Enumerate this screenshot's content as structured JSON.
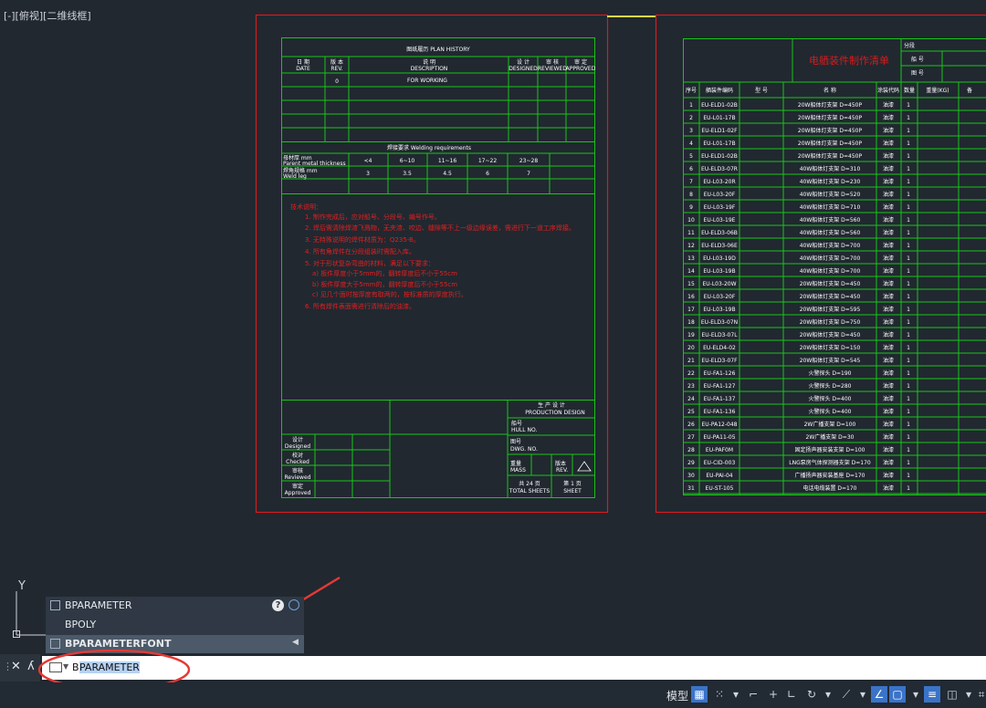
{
  "viewport": {
    "label": "[-][俯视][二维线框]"
  },
  "drawing": {
    "plan_history": {
      "title": "图纸履历 PLAN HISTORY",
      "headers": [
        {
          "cn": "日 期",
          "en": "DATE"
        },
        {
          "cn": "版 本",
          "en": "REV."
        },
        {
          "cn": "说 明",
          "en": "DESCRIPTION"
        },
        {
          "cn": "设 计",
          "en": "DESIGNED"
        },
        {
          "cn": "审 核",
          "en": "REVIEWED"
        },
        {
          "cn": "审 定",
          "en": "APPROVED"
        }
      ],
      "row1": {
        "rev": "0",
        "desc": "FOR WORKING"
      }
    },
    "welding": {
      "title": "焊接要求 Welding requirements",
      "row1_label_cn": "母材厚 mm",
      "row1_label_en": "Parent metal thickness",
      "row2_label_cn": "焊角规格 mm",
      "row2_label_en": "Weld leg",
      "thickness": [
        "<4",
        "6~10",
        "11~16",
        "17~22",
        "23~28"
      ],
      "leg": [
        "3",
        "3.5",
        "4.5",
        "6",
        "7"
      ]
    },
    "notes": [
      "技术说明：",
      "1. 制作完成后，应对船号、分段号、编号作号。",
      "2. 焊后需清除焊渣飞溅物，无夹渣、咬边、缝隙等不上一级边缘误差，需进行下一道工序焊接。",
      "3. 无特殊说明的焊件材质为：Q235-B。",
      "4. 所有角焊件在分段组装时需配入库。",
      "5. 对于形状复杂弯曲的材料，满足以下要求：",
      "a) 板件厚度小于5mm的，翻转厚度后不小于55cm",
      "b) 板件厚度大于5mm的，翻转厚度后不小于55cm",
      "c) 见几个面时按厚度有取两的，按标准质的厚度执行。",
      "6. 所有焊件表面需进行清除后的油漆。"
    ],
    "production": {
      "cn": "生 产 设 计",
      "en": "PRODUCTION DESIGN"
    },
    "hull": {
      "cn": "船号",
      "en": "HULL NO."
    },
    "dwg": {
      "cn": "图号",
      "en": "DWG. NO."
    },
    "mass": {
      "cn": "重量",
      "en": "MASS"
    },
    "rev": {
      "cn": "版本",
      "en": "REV."
    },
    "total": {
      "cn": "共 24 页",
      "en": "TOTAL SHEETS"
    },
    "sheet": {
      "cn": "第 1 页",
      "en": "SHEET"
    },
    "signoff": [
      {
        "cn": "设计",
        "en": "Designed"
      },
      {
        "cn": "校对",
        "en": "Checked"
      },
      {
        "cn": "审核",
        "en": "Reviewed"
      },
      {
        "cn": "审定",
        "en": "Approved"
      }
    ],
    "list": {
      "title": "电舾装件制作清单",
      "side": [
        "分段",
        "船 号",
        "图 号"
      ],
      "headers": [
        "序号",
        "舾装件编码",
        "型 号",
        "名 称",
        "涂装代码",
        "数量",
        "重量(KG)",
        "备"
      ],
      "rows": [
        [
          "1",
          "EU-ELD1-02B",
          "20W船体灯支架 D=450P"
        ],
        [
          "2",
          "EU-L01-17B",
          "20W船体灯支架 D=450P"
        ],
        [
          "3",
          "EU-ELD1-02F",
          "20W船体灯支架 D=450P"
        ],
        [
          "4",
          "EU-L01-17B",
          "20W船体灯支架 D=450P"
        ],
        [
          "5",
          "EU-ELD1-02B",
          "20W船体灯支架 D=450P"
        ],
        [
          "6",
          "EU-ELD3-07R",
          "40W船体灯支架 D=310"
        ],
        [
          "7",
          "EU-L03-20R",
          "40W船体灯支架 D=230"
        ],
        [
          "8",
          "EU-L03-20F",
          "40W船体灯支架 D=520"
        ],
        [
          "9",
          "EU-L03-19F",
          "40W船体灯支架 D=710"
        ],
        [
          "10",
          "EU-L03-19E",
          "40W船体灯支架 D=560"
        ],
        [
          "11",
          "EU-ELD3-06B",
          "40W船体灯支架 D=560"
        ],
        [
          "12",
          "EU-ELD3-06E",
          "40W船体灯支架 D=700"
        ],
        [
          "13",
          "EU-L03-19D",
          "40W船体灯支架 D=700"
        ],
        [
          "14",
          "EU-L03-19B",
          "40W船体灯支架 D=700"
        ],
        [
          "15",
          "EU-L03-20W",
          "20W船体灯支架 D=450"
        ],
        [
          "16",
          "EU-L03-20F",
          "20W船体灯支架 D=450"
        ],
        [
          "17",
          "EU-L03-19B",
          "20W船体灯支架 D=595"
        ],
        [
          "18",
          "EU-ELD3-07N",
          "20W船体灯支架 D=750"
        ],
        [
          "19",
          "EU-ELD3-07L",
          "20W船体灯支架 D=450"
        ],
        [
          "20",
          "EU-ELD4-02",
          "20W船体灯支架 D=150"
        ],
        [
          "21",
          "EU-ELD3-07F",
          "20W船体灯支架 D=545"
        ],
        [
          "22",
          "EU-FA1-126",
          "火警探头 D=190"
        ],
        [
          "23",
          "EU-FA1-127",
          "火警探头 D=280"
        ],
        [
          "24",
          "EU-FA1-137",
          "火警探头 D=400"
        ],
        [
          "25",
          "EU-FA1-136",
          "火警探头 D=400"
        ],
        [
          "26",
          "EU-PA12-048",
          "2W广播支架 D=100"
        ],
        [
          "27",
          "EU-PA11-05",
          "2W广播支架 D=30"
        ],
        [
          "28",
          "EU-PAF0M",
          "固定扬声器安装支架 D=100"
        ],
        [
          "29",
          "EU-CID-003",
          "LNG泵房气体探测器支架 D=170"
        ],
        [
          "30",
          "EU-PAI-04",
          "广播扬声器安装基座 D=170"
        ],
        [
          "31",
          "EU-ST-105",
          "电话电缆装置 D=170"
        ]
      ],
      "paint": "油漆",
      "qty": "1"
    }
  },
  "ucs": {
    "y_label": "Y"
  },
  "autocomplete": {
    "items": [
      {
        "label": "BPARAMETER",
        "icon": "block-icon",
        "selected": false
      },
      {
        "label": "BPOLY",
        "icon": "",
        "selected": false
      },
      {
        "label": "BPARAMETERFONT",
        "icon": "system-variable-icon",
        "selected": true
      }
    ],
    "help_icon": "?",
    "search_icon": "globe-search-icon"
  },
  "command": {
    "typed": "B",
    "completion": "PARAMETER",
    "icon": "command-prompt-icon"
  },
  "status": {
    "model": "模型"
  },
  "colors": {
    "background": "#212830",
    "frame_red": "#d81b1b",
    "lines_green": "#19c419",
    "accent_blue": "#3a73c8",
    "annotation_red": "#e53935"
  }
}
